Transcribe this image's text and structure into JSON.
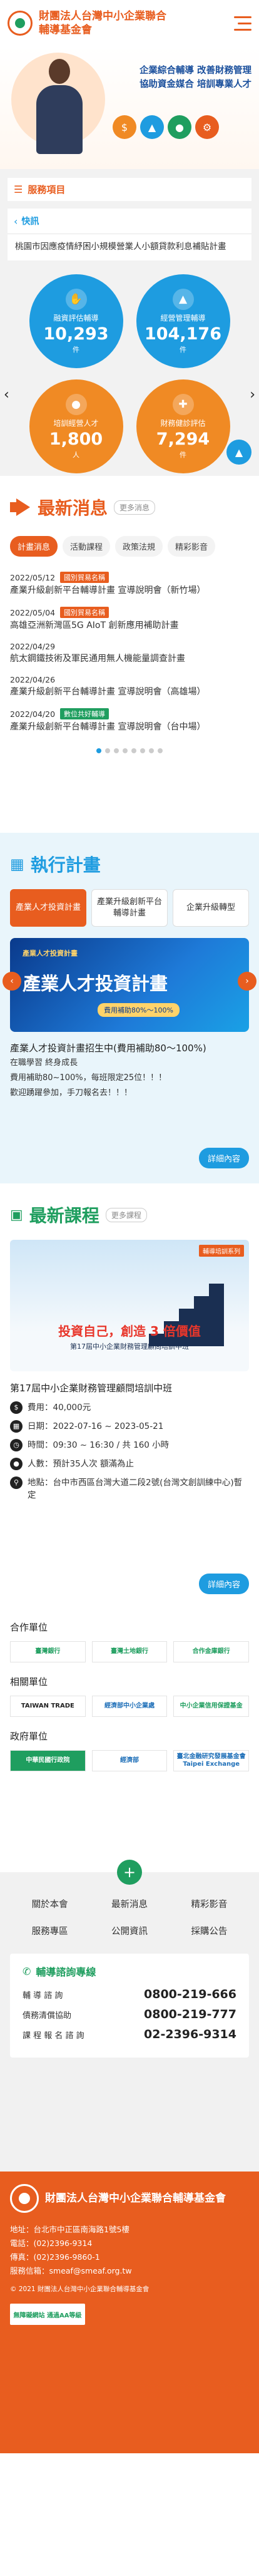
{
  "header": {
    "org_name": "財團法人台灣中小企業聯合輔導基金會"
  },
  "hero": {
    "line1": "企業綜合輔導 改善財務管理",
    "line2": "協助資金媒合 培訓專業人才"
  },
  "services": {
    "title": "服務項目",
    "quick_label": "快訊",
    "quick_text": "桃園市因應疫情紓困小規模營業人小額貸款利息補貼計畫",
    "stats": [
      {
        "label": "融資評估輔導",
        "value": "10,293",
        "unit": "件",
        "color": "#1e9ce0",
        "icon": "handshake-icon"
      },
      {
        "label": "經營管理輔導",
        "value": "104,176",
        "unit": "件",
        "color": "#1e9ce0",
        "icon": "chart-icon"
      },
      {
        "label": "培訓經營人才",
        "value": "1,800",
        "unit": "人",
        "color": "#f08a24",
        "icon": "people-icon"
      },
      {
        "label": "財務健診評估",
        "value": "7,294",
        "unit": "件",
        "color": "#f08a24",
        "icon": "stethoscope-icon"
      }
    ]
  },
  "news": {
    "title": "最新消息",
    "more": "更多消息",
    "tabs": [
      "計畫消息",
      "活動課程",
      "政策法規",
      "精彩影音"
    ],
    "items": [
      {
        "date": "2022/05/12",
        "tag": "國別貿易名稱",
        "tag_color": "#e85d1f",
        "title": "產業升級創新平台輔導計畫 宣導說明會（新竹場）"
      },
      {
        "date": "2022/05/04",
        "tag": "國別貿易名稱",
        "tag_color": "#e85d1f",
        "title": "高雄亞洲新灣區5G AIoT 創新應用補助計畫"
      },
      {
        "date": "2022/04/29",
        "tag": "",
        "tag_color": "",
        "title": "航太鋼鐵技術及軍民通用無人機能量調查計畫"
      },
      {
        "date": "2022/04/26",
        "tag": "",
        "tag_color": "",
        "title": "產業升級創新平台輔導計畫 宣導說明會（高雄場）"
      },
      {
        "date": "2022/04/20",
        "tag": "數位共好輔導",
        "tag_color": "#1f9e5f",
        "title": "產業升級創新平台輔導計畫 宣導說明會（台中場）"
      }
    ]
  },
  "plans": {
    "title": "執行計畫",
    "tabs": [
      "產業人才投資計畫",
      "產業升級創新平台輔導計畫",
      "企業升級轉型"
    ],
    "banner_small": "產業人才投資計畫",
    "banner_title": "產業人才投資計畫",
    "banner_pill": "費用補助80%～100%",
    "desc_title": "產業人才投資計畫招生中(費用補助80～100%)",
    "desc_lines": [
      "在職學習 終身成長",
      "費用補助80~100%，每班限定25位！！！",
      "歡迎踴躍參加，手刀報名去！！！"
    ],
    "detail": "詳細內容"
  },
  "courses": {
    "title": "最新課程",
    "more": "更多課程",
    "img_tag": "輔導培訓系列",
    "img_caption": "投資自己，創造 3 倍價值",
    "img_sub": "第17屆中小企業財務管理顧問培訓中班",
    "course_title": "第17屆中小企業財務管理顧問培訓中班",
    "fee": "費用：40,000元",
    "date": "日期：2022-07-16 ~ 2023-05-21",
    "time": "時間：09:30 ~ 16:30 / 共 160 小時",
    "people": "人數：預計35人次 額滿為止",
    "place": "地點：台中市西區台灣大道二段2號(台灣文創訓練中心)暫定",
    "detail": "詳細內容"
  },
  "partners": {
    "groups": [
      {
        "title": "合作單位",
        "logos": [
          "臺灣銀行",
          "臺灣土地銀行",
          "合作金庫銀行"
        ]
      },
      {
        "title": "相關單位",
        "logos": [
          "TAIWAN TRADE",
          "經濟部中小企業處",
          "中小企業信用保證基金"
        ]
      },
      {
        "title": "政府單位",
        "logos": [
          "中華民國行政院",
          "經濟部",
          "臺北金融研究發展基金會 Taipei Exchange"
        ]
      }
    ]
  },
  "footer_links": {
    "links": [
      "關於本會",
      "最新消息",
      "精彩影音",
      "服務專區",
      "公開資訊",
      "採購公告"
    ],
    "hotline_title": "輔導諮詢專線",
    "hotlines": [
      {
        "label": "輔 導 諮 詢",
        "num": "0800-219-666"
      },
      {
        "label": "債務清償協助",
        "num": "0800-219-777"
      },
      {
        "label": "課 程 報 名 諮 詢",
        "num": "02-2396-9314"
      }
    ]
  },
  "site_footer": {
    "name": "財團法人台灣中小企業聯合輔導基金會",
    "address": "地址：台北市中正區南海路1號5樓",
    "tel": "電話：(02)2396-9314",
    "fax": "傳真：(02)2396-9860-1",
    "email": "服務信箱：smeaf@smeaf.org.tw",
    "copyright": "© 2021 財團法人台灣中小企業聯合輔導基金會",
    "badge": "無障礙網站 通過AA等級"
  },
  "colors": {
    "brand": "#e85d1f",
    "blue": "#1e9ce0",
    "green": "#1f9e5f"
  }
}
